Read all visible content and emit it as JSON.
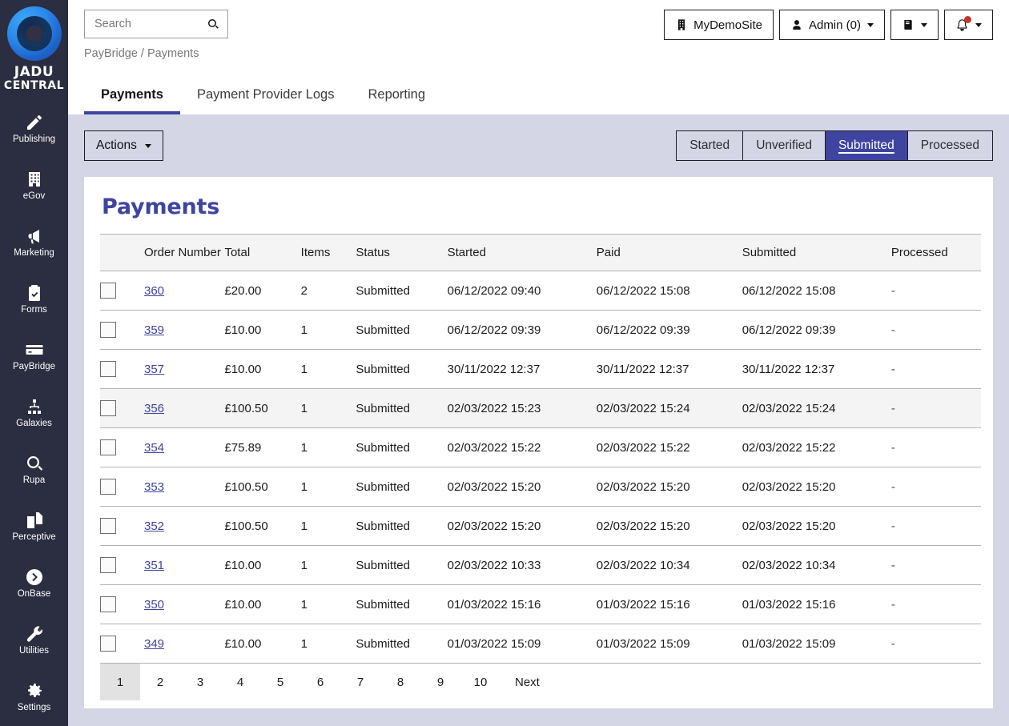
{
  "brand": {
    "name_line1": "JADU",
    "name_line2": "CENTRAL",
    "logo_icon": "jadu-ring-logo"
  },
  "sidebar": {
    "items": [
      {
        "label": "Publishing",
        "icon": "pencil-icon"
      },
      {
        "label": "eGov",
        "icon": "building-icon"
      },
      {
        "label": "Marketing",
        "icon": "megaphone-icon"
      },
      {
        "label": "Forms",
        "icon": "clipboard-check-icon"
      },
      {
        "label": "PayBridge",
        "icon": "credit-card-icon"
      },
      {
        "label": "Galaxies",
        "icon": "sitemap-icon"
      },
      {
        "label": "Rupa",
        "icon": "magnifier-icon"
      },
      {
        "label": "Perceptive",
        "icon": "copy-documents-icon"
      },
      {
        "label": "OnBase",
        "icon": "circle-arrow-right-icon"
      },
      {
        "label": "Utilities",
        "icon": "wrench-icon"
      },
      {
        "label": "Settings",
        "icon": "gear-icon"
      }
    ]
  },
  "header": {
    "search": {
      "placeholder": "Search",
      "value": ""
    },
    "breadcrumb": "PayBridge / Payments",
    "site_button": "MyDemoSite",
    "account_button": "Admin (0)",
    "manual_button": "",
    "notifications_button": "",
    "notification_dot_color": "#c0392b"
  },
  "tabs": [
    {
      "label": "Payments",
      "active": true
    },
    {
      "label": "Payment Provider Logs",
      "active": false
    },
    {
      "label": "Reporting",
      "active": false
    }
  ],
  "toolbar": {
    "actions_label": "Actions",
    "filters": [
      {
        "label": "Started",
        "active": false
      },
      {
        "label": "Unverified",
        "active": false
      },
      {
        "label": "Submitted",
        "active": true
      },
      {
        "label": "Processed",
        "active": false
      }
    ]
  },
  "card": {
    "title": "Payments",
    "columns": [
      "",
      "Order Number",
      "Total",
      "Items",
      "Status",
      "Started",
      "Paid",
      "Submitted",
      "Processed"
    ],
    "rows": [
      {
        "order": "360",
        "total": "£20.00",
        "items": "2",
        "status": "Submitted",
        "started": "06/12/2022 09:40",
        "paid": "06/12/2022 15:08",
        "submitted": "06/12/2022 15:08",
        "processed": "-",
        "highlight": false
      },
      {
        "order": "359",
        "total": "£10.00",
        "items": "1",
        "status": "Submitted",
        "started": "06/12/2022 09:39",
        "paid": "06/12/2022 09:39",
        "submitted": "06/12/2022 09:39",
        "processed": "-",
        "highlight": false
      },
      {
        "order": "357",
        "total": "£10.00",
        "items": "1",
        "status": "Submitted",
        "started": "30/11/2022 12:37",
        "paid": "30/11/2022 12:37",
        "submitted": "30/11/2022 12:37",
        "processed": "-",
        "highlight": false
      },
      {
        "order": "356",
        "total": "£100.50",
        "items": "1",
        "status": "Submitted",
        "started": "02/03/2022 15:23",
        "paid": "02/03/2022 15:24",
        "submitted": "02/03/2022 15:24",
        "processed": "-",
        "highlight": true
      },
      {
        "order": "354",
        "total": "£75.89",
        "items": "1",
        "status": "Submitted",
        "started": "02/03/2022 15:22",
        "paid": "02/03/2022 15:22",
        "submitted": "02/03/2022 15:22",
        "processed": "-",
        "highlight": false
      },
      {
        "order": "353",
        "total": "£100.50",
        "items": "1",
        "status": "Submitted",
        "started": "02/03/2022 15:20",
        "paid": "02/03/2022 15:20",
        "submitted": "02/03/2022 15:20",
        "processed": "-",
        "highlight": false
      },
      {
        "order": "352",
        "total": "£100.50",
        "items": "1",
        "status": "Submitted",
        "started": "02/03/2022 15:20",
        "paid": "02/03/2022 15:20",
        "submitted": "02/03/2022 15:20",
        "processed": "-",
        "highlight": false
      },
      {
        "order": "351",
        "total": "£10.00",
        "items": "1",
        "status": "Submitted",
        "started": "02/03/2022 10:33",
        "paid": "02/03/2022 10:34",
        "submitted": "02/03/2022 10:34",
        "processed": "-",
        "highlight": false
      },
      {
        "order": "350",
        "total": "£10.00",
        "items": "1",
        "status": "Submitted",
        "started": "01/03/2022 15:16",
        "paid": "01/03/2022 15:16",
        "submitted": "01/03/2022 15:16",
        "processed": "-",
        "highlight": false
      },
      {
        "order": "349",
        "total": "£10.00",
        "items": "1",
        "status": "Submitted",
        "started": "01/03/2022 15:09",
        "paid": "01/03/2022 15:09",
        "submitted": "01/03/2022 15:09",
        "processed": "-",
        "highlight": false
      }
    ]
  },
  "pagination": {
    "pages": [
      "1",
      "2",
      "3",
      "4",
      "5",
      "6",
      "7",
      "8",
      "9",
      "10"
    ],
    "active_page": "1",
    "next_label": "Next"
  },
  "colors": {
    "accent": "#3f44a0",
    "sidebar_bg": "#2b2d40",
    "content_bg": "#d4d6e6",
    "row_highlight": "#f4f4f4",
    "notification": "#c0392b"
  }
}
